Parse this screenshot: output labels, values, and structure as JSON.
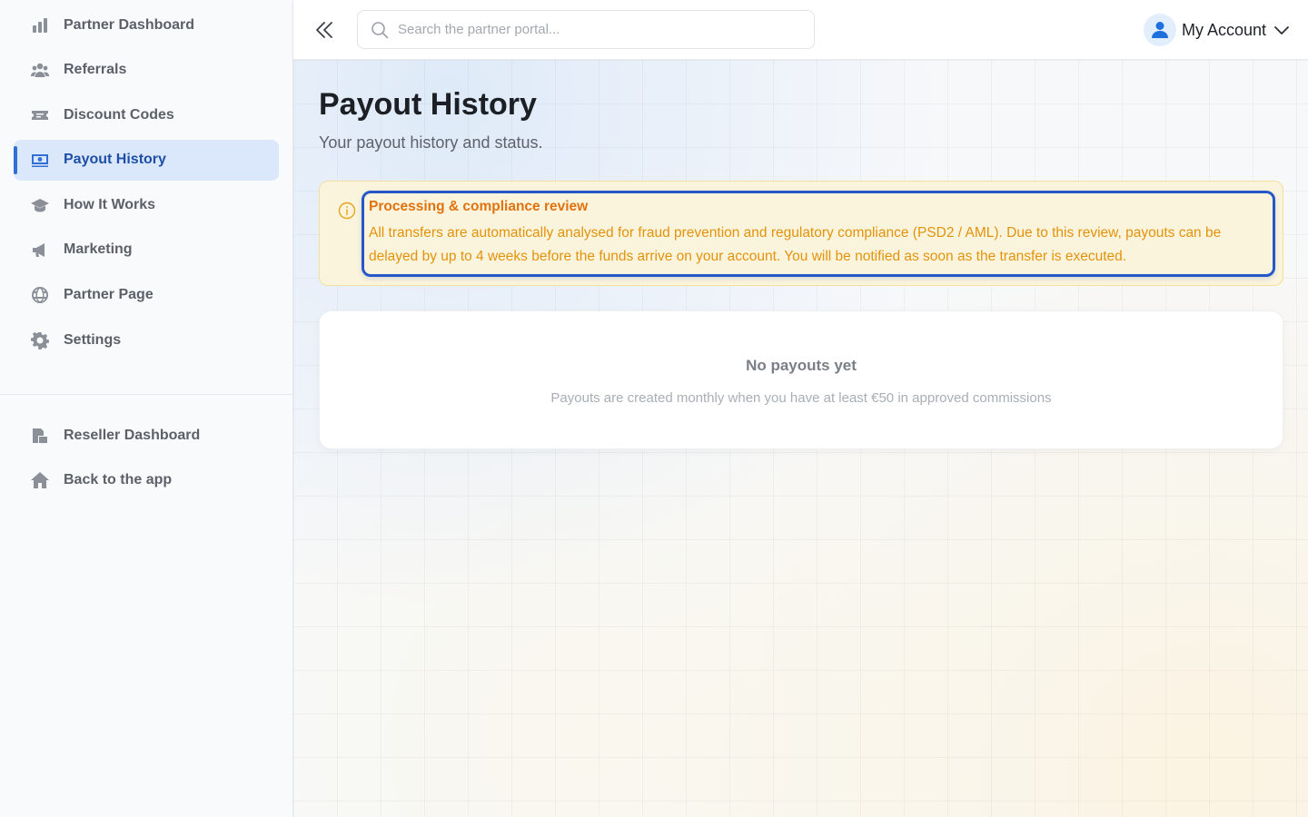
{
  "sidebar": {
    "primary_items": [
      {
        "label": "Partner Dashboard",
        "icon": "bar-chart-icon"
      },
      {
        "label": "Referrals",
        "icon": "users-icon"
      },
      {
        "label": "Discount Codes",
        "icon": "ticket-icon"
      },
      {
        "label": "Payout History",
        "icon": "money-bill-icon",
        "active": true
      },
      {
        "label": "How It Works",
        "icon": "graduation-cap-icon"
      },
      {
        "label": "Marketing",
        "icon": "megaphone-icon"
      },
      {
        "label": "Partner Page",
        "icon": "globe-icon"
      },
      {
        "label": "Settings",
        "icon": "gear-icon"
      }
    ],
    "secondary_items": [
      {
        "label": "Reseller Dashboard",
        "icon": "reseller-icon"
      },
      {
        "label": "Back to the app",
        "icon": "home-icon"
      }
    ]
  },
  "topbar": {
    "search_placeholder": "Search the partner portal...",
    "account_label": "My Account"
  },
  "page": {
    "title": "Payout History",
    "subtitle": "Your payout history and status."
  },
  "notice": {
    "title": "Processing & compliance review",
    "text": "All transfers are automatically analysed for fraud prevention and regulatory compliance (PSD2 / AML). Due to this review, payouts can be delayed by up to 4 weeks before the funds arrive on your account. You will be notified as soon as the transfer is executed."
  },
  "empty_state": {
    "title": "No payouts yet",
    "text": "Payouts are created monthly when you have at least €50 in approved commissions"
  },
  "colors": {
    "accent": "#2f6fd6",
    "active_bg": "#dbe8fb",
    "notice_bg": "#fbf4dc",
    "notice_title": "#e0720f",
    "notice_text": "#e2930c",
    "highlight_border": "#2557c9"
  }
}
